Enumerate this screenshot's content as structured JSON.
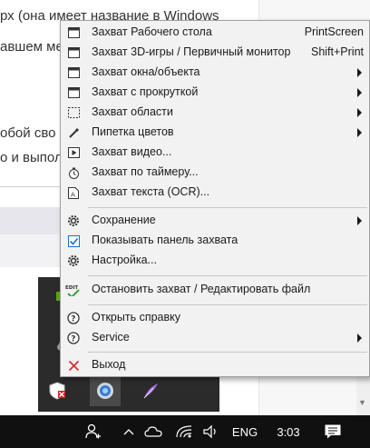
{
  "background": {
    "lines": [
      "рх (она имеет название в Windows",
      "авшем ме",
      "обой сво",
      "о и выпол"
    ]
  },
  "menu": {
    "items": [
      {
        "label": "Захват Рабочего стола",
        "shortcut": "PrintScreen",
        "icon": "window-icon"
      },
      {
        "label": "Захват 3D-игры / Первичный монитор",
        "shortcut": "Shift+Print",
        "icon": "window-icon"
      },
      {
        "label": "Захват окна/объекта",
        "icon": "window-icon"
      },
      {
        "label": "Захват с прокруткой",
        "icon": "window-icon"
      },
      {
        "label": "Захват области",
        "icon": "dashed-region-icon"
      },
      {
        "label": "Пипетка цветов",
        "icon": "eyedropper-icon"
      },
      {
        "label": "Захват видео...",
        "icon": "video-icon"
      },
      {
        "label": "Захват по таймеру...",
        "icon": "timer-icon"
      },
      {
        "label": "Захват текста (OCR)...",
        "icon": "text-document-icon"
      },
      {
        "label": "Сохранение",
        "icon": "gear-icon"
      },
      {
        "label": "Показывать панель захвата",
        "icon": "checkbox-checked-icon"
      },
      {
        "label": "Настройка...",
        "icon": "gear-icon"
      },
      {
        "label": "Остановить захват / Редактировать файл",
        "icon_text": "EDIT",
        "icon": "edit-check-icon"
      },
      {
        "label": "Открыть справку",
        "icon": "help-icon"
      },
      {
        "label": "Service",
        "icon": "help-icon"
      },
      {
        "label": "Выход",
        "icon": "close-icon"
      }
    ]
  },
  "taskbar": {
    "language": "ENG",
    "time": "3:03"
  },
  "colors": {
    "menu_bg": "#f2f2f2",
    "accent": "#1a6fd0",
    "exit_red": "#d23030",
    "check_green": "#3aa13a",
    "taskbar_bg": "#101010"
  }
}
